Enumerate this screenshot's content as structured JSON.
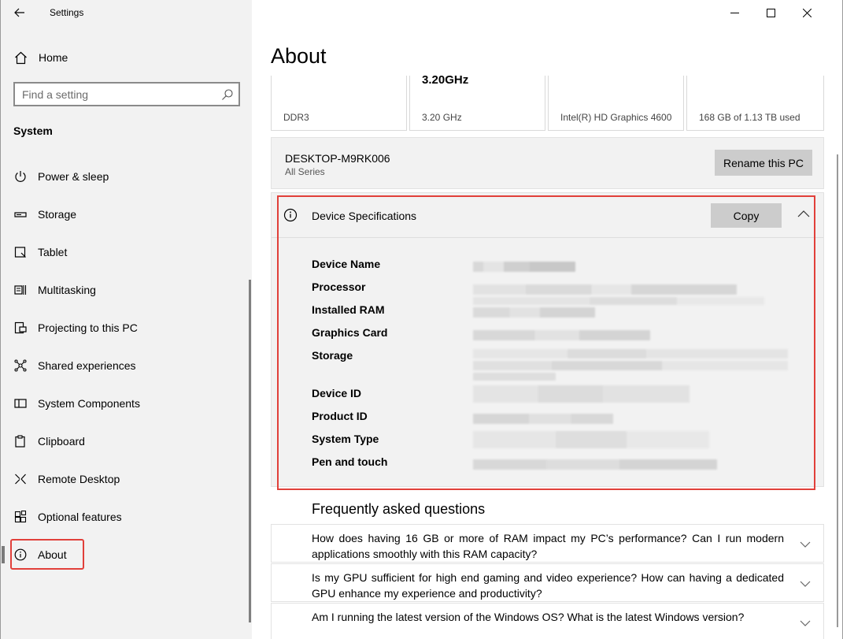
{
  "window": {
    "app_title": "Settings",
    "controls": [
      "minimize",
      "maximize",
      "close"
    ]
  },
  "sidebar": {
    "home_label": "Home",
    "search_placeholder": "Find a setting",
    "section_title": "System",
    "items": [
      {
        "label": "Power & sleep",
        "icon": "power-icon"
      },
      {
        "label": "Storage",
        "icon": "storage-icon"
      },
      {
        "label": "Tablet",
        "icon": "tablet-icon"
      },
      {
        "label": "Multitasking",
        "icon": "multitasking-icon"
      },
      {
        "label": "Projecting to this PC",
        "icon": "projecting-icon"
      },
      {
        "label": "Shared experiences",
        "icon": "shared-icon"
      },
      {
        "label": "System Components",
        "icon": "components-icon"
      },
      {
        "label": "Clipboard",
        "icon": "clipboard-icon"
      },
      {
        "label": "Remote Desktop",
        "icon": "remote-desktop-icon"
      },
      {
        "label": "Optional features",
        "icon": "optional-features-icon"
      },
      {
        "label": "About",
        "icon": "info-icon",
        "selected": true
      }
    ]
  },
  "main": {
    "page_title": "About",
    "spec_cards": [
      {
        "value": "",
        "caption": "DDR3"
      },
      {
        "value": "3.20GHz",
        "caption": "3.20 GHz"
      },
      {
        "value": "",
        "caption": "Intel(R) HD Graphics 4600"
      },
      {
        "value": "",
        "caption": "168 GB of 1.13 TB used"
      }
    ],
    "pc_card": {
      "name": "DESKTOP-M9RK006",
      "model": "All Series",
      "rename_label": "Rename this PC"
    },
    "device_specs": {
      "title": "Device Specifications",
      "copy_label": "Copy",
      "rows": [
        {
          "label": "Device Name",
          "redacted": true
        },
        {
          "label": "Processor",
          "redacted": true
        },
        {
          "label": "Installed RAM",
          "redacted": true
        },
        {
          "label": "Graphics Card",
          "redacted": true
        },
        {
          "label": "Storage",
          "redacted": true
        },
        {
          "label": "Device ID",
          "redacted": true
        },
        {
          "label": "Product ID",
          "redacted": true
        },
        {
          "label": "System Type",
          "redacted": true
        },
        {
          "label": "Pen and touch",
          "redacted": true
        }
      ]
    },
    "faq": {
      "title": "Frequently asked questions",
      "items": [
        {
          "question": "How does having 16 GB or more of RAM impact my PC’s performance? Can I run modern applications smoothly with this RAM capacity?"
        },
        {
          "question": "Is my GPU sufficient for high end gaming and video experience? How can having a dedicated GPU enhance my experience and productivity?"
        },
        {
          "question": "Am I running the latest version of the Windows OS? What is the latest Windows version?"
        }
      ]
    }
  },
  "colors": {
    "highlight_red": "#e1403a",
    "sidebar_bg": "#f2f2f2",
    "button_gray": "#cccccc"
  }
}
